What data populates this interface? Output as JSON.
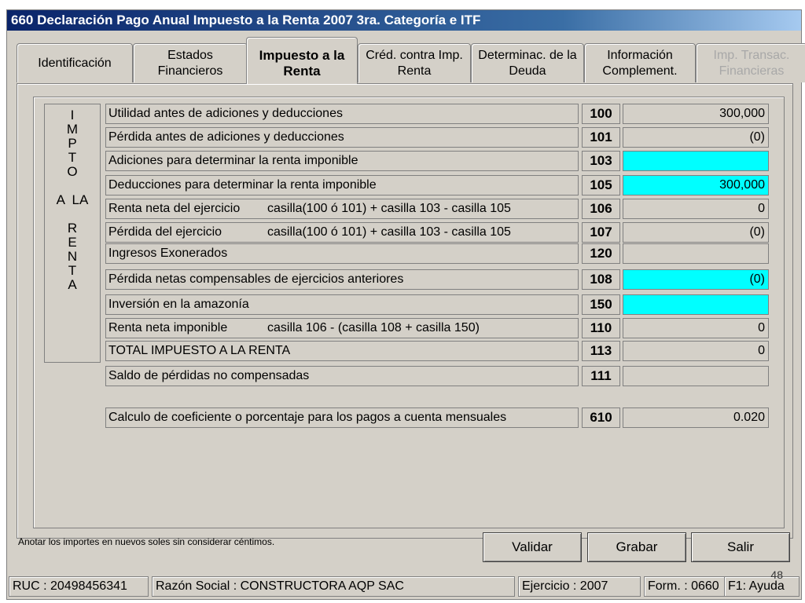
{
  "window": {
    "title": "660 Declaración Pago Anual Impuesto a la Renta 2007 3ra. Categoría e ITF"
  },
  "tabs": [
    {
      "label": "Identificación"
    },
    {
      "label": "Estados\nFinancieros"
    },
    {
      "label": "Impuesto a  la\nRenta"
    },
    {
      "label": "Créd. contra Imp.\nRenta"
    },
    {
      "label": "Determinac. de la\nDeuda"
    },
    {
      "label": "Información\nComplement."
    },
    {
      "label": "Imp. Transac.\nFinancieras"
    }
  ],
  "side_label": "I\nM\nP\nT\nO\n\nA  LA\n\nR\nE\nN\nT\nA",
  "rows": [
    {
      "label": "Utilidad antes de adiciones y deducciones",
      "formula": "",
      "code": "100",
      "value": "300,000",
      "input": false
    },
    {
      "label": "Pérdida antes de adiciones y deducciones",
      "formula": "",
      "code": "101",
      "value": "(0)",
      "input": false
    },
    {
      "label": "Adiciones para determinar la renta imponible",
      "formula": "",
      "code": "103",
      "value": "",
      "input": true
    },
    {
      "label": "Deducciones para determinar la renta imponible",
      "formula": "",
      "code": "105",
      "value": "300,000",
      "input": true
    },
    {
      "label": "Renta neta del ejercicio",
      "formula": "casilla(100 ó 101) + casilla 103 - casilla 105",
      "code": "106",
      "value": "0",
      "input": false
    },
    {
      "label": "Pérdida del ejercicio",
      "formula": "casilla(100 ó 101) + casilla 103 - casilla 105",
      "code": "107",
      "value": "(0)",
      "input": false
    },
    {
      "label": "Ingresos Exonerados",
      "formula": "",
      "code": "120",
      "value": "",
      "input": false
    },
    {
      "label": "Pérdida netas compensables de ejercicios anteriores",
      "formula": "",
      "code": "108",
      "value": "(0)",
      "input": true
    },
    {
      "label": "Inversión en la amazonía",
      "formula": "",
      "code": "150",
      "value": "",
      "input": true
    },
    {
      "label": "Renta neta imponible",
      "formula": "casilla 106 - (casilla 108 + casilla 150)",
      "code": "110",
      "value": "0",
      "input": false
    },
    {
      "label": "TOTAL IMPUESTO A LA RENTA",
      "formula": "",
      "code": "113",
      "value": "0",
      "input": false
    },
    {
      "label": "Saldo de pérdidas no compensadas",
      "formula": "",
      "code": "111",
      "value": "",
      "input": false
    },
    {
      "label": "Calculo de coeficiente o porcentaje para los pagos a cuenta mensuales",
      "formula": "",
      "code": "610",
      "value": "0.020",
      "input": false
    }
  ],
  "note": "Anotar los importes en nuevos soles sin considerar céntimos.",
  "buttons": {
    "validar": "Validar",
    "grabar": "Grabar",
    "salir": "Salir"
  },
  "status": {
    "ruc": "RUC : 20498456341",
    "razon": "Razón Social : CONSTRUCTORA AQP SAC",
    "ejercicio": "Ejercicio : 2007",
    "form": "Form. : 0660",
    "help": "F1: Ayuda"
  },
  "slide_number": "48",
  "colors": {
    "input_field": "#00ffff",
    "window_bg": "#d4d0c8",
    "titlebar": "#0a246a"
  }
}
